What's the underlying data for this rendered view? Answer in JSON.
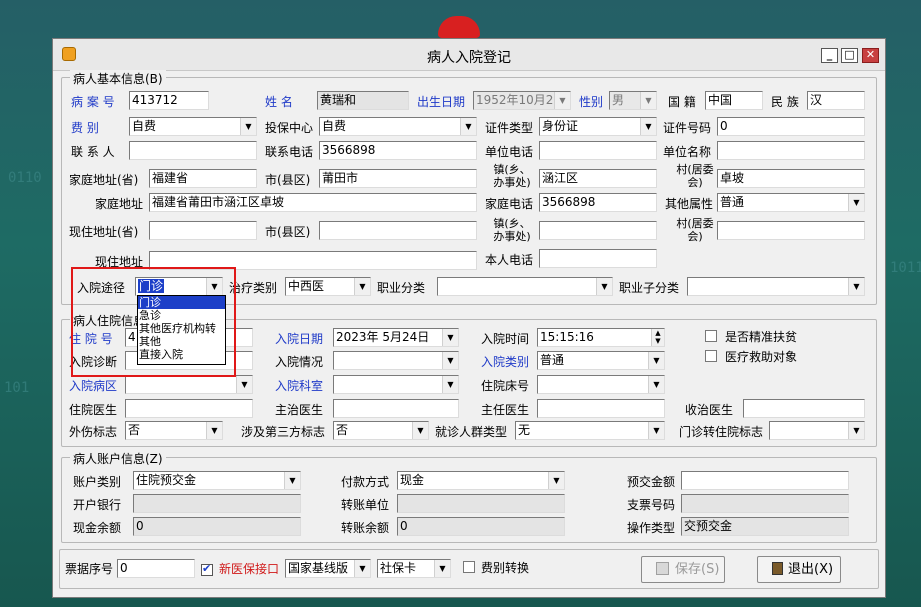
{
  "window": {
    "title": "病人入院登记",
    "min": "_",
    "max": "□",
    "close": "✕"
  },
  "basic": {
    "legend": "病人基本信息(B)",
    "case_no_label": "病 案 号",
    "case_no": "413712",
    "name_label": "姓    名",
    "name": "黄瑞和",
    "dob_label": "出生日期",
    "dob": "1952年10月2",
    "gender_label": "性别",
    "gender": "男",
    "nation_label": "国  籍",
    "nation": "中国",
    "ethnic_label": "民 族",
    "ethnic": "汉",
    "fee_label": "费    别",
    "fee": "自费",
    "insure_center_label": "投保中心",
    "insure_center": "自费",
    "id_type_label": "证件类型",
    "id_type": "身份证",
    "id_no_label": "证件号码",
    "id_no": "0",
    "contact_label": "联 系 人",
    "contact": "",
    "contact_phone_label": "联系电话",
    "contact_phone": "3566898",
    "work_phone_label": "单位电话",
    "work_phone": "",
    "work_name_label": "单位名称",
    "work_name": "",
    "home_prov_label": "家庭地址(省)",
    "home_prov": "福建省",
    "home_city_label": "市(县区)",
    "home_city": "莆田市",
    "home_town_label": "镇(乡、办事处)",
    "home_town": "涵江区",
    "home_village_label": "村(居委会)",
    "home_village": "卓坡",
    "home_addr_label": "家庭地址",
    "home_addr": "福建省莆田市涵江区卓坡",
    "home_phone_label": "家庭电话",
    "home_phone": "3566898",
    "other_attr_label": "其他属性",
    "other_attr": "普通",
    "cur_prov_label": "现住地址(省)",
    "cur_prov": "",
    "cur_city_label": "市(县区)",
    "cur_city": "",
    "cur_town_label": "镇(乡、办事处)",
    "cur_town": "",
    "cur_village_label": "村(居委会)",
    "cur_village": "",
    "cur_addr_label": "现住地址",
    "cur_addr": "",
    "self_phone_label": "本人电话",
    "self_phone": "",
    "admit_route_label": "入院途径",
    "admit_route": "门诊",
    "treat_type_label": "治疗类别",
    "treat_type": "中西医",
    "job_label": "职业分类",
    "job": "",
    "job_sub_label": "职业子分类",
    "job_sub": "",
    "route_options": [
      "门诊",
      "急诊",
      "其他医疗机构转",
      "其他",
      "直接入院"
    ]
  },
  "inpatient": {
    "legend": "病人住院信息",
    "hosp_no_label": "住 院 号",
    "hosp_no": "4",
    "admit_date_label": "入院日期",
    "admit_date": "2023年 5月24日",
    "admit_time_label": "入院时间",
    "admit_time": "15:15:16",
    "poverty_label": "是否精准扶贫",
    "diag_label": "入院诊断",
    "diag": "",
    "cond_label": "入院情况",
    "cond": "",
    "admit_cat_label": "入院类别",
    "admit_cat": "普通",
    "aid_label": "医疗救助对象",
    "ward_label": "入院病区",
    "ward": "",
    "dept_label": "入院科室",
    "dept": "",
    "bed_label": "住院床号",
    "bed": "",
    "doctor_label": "住院医生",
    "doctor": "",
    "attending_label": "主治医生",
    "attending": "",
    "chief_label": "主任医生",
    "chief": "",
    "admit_doc_label": "收治医生",
    "admit_doc": "",
    "trauma_label": "外伤标志",
    "trauma": "否",
    "third_label": "涉及第三方标志",
    "third": "否",
    "crowd_label": "就诊人群类型",
    "crowd": "无",
    "transfer_label": "门诊转住院标志",
    "transfer": ""
  },
  "account": {
    "legend": "病人账户信息(Z)",
    "acct_type_label": "账户类别",
    "acct_type": "住院预交金",
    "pay_label": "付款方式",
    "pay": "现金",
    "prepay_label": "预交金额",
    "prepay": "",
    "bank_label": "开户银行",
    "bank": "",
    "trans_unit_label": "转账单位",
    "trans_unit": "",
    "cheque_label": "支票号码",
    "cheque": "",
    "cash_bal_label": "现金余额",
    "cash_bal": "0",
    "trans_bal_label": "转账余额",
    "trans_bal": "0",
    "op_type_label": "操作类型",
    "op_type": "交预交金"
  },
  "footer": {
    "receipt_label": "票据序号",
    "receipt": "0",
    "new_ins_label": "新医保接口",
    "nat_ver": "国家基线版",
    "card": "社保卡",
    "fee_trans_label": "费别转换",
    "save_label": "保存(S)",
    "exit_label": "退出(X)"
  },
  "bg": {
    "digits1": "0110",
    "digits2": "1011",
    "digits3": "101"
  }
}
